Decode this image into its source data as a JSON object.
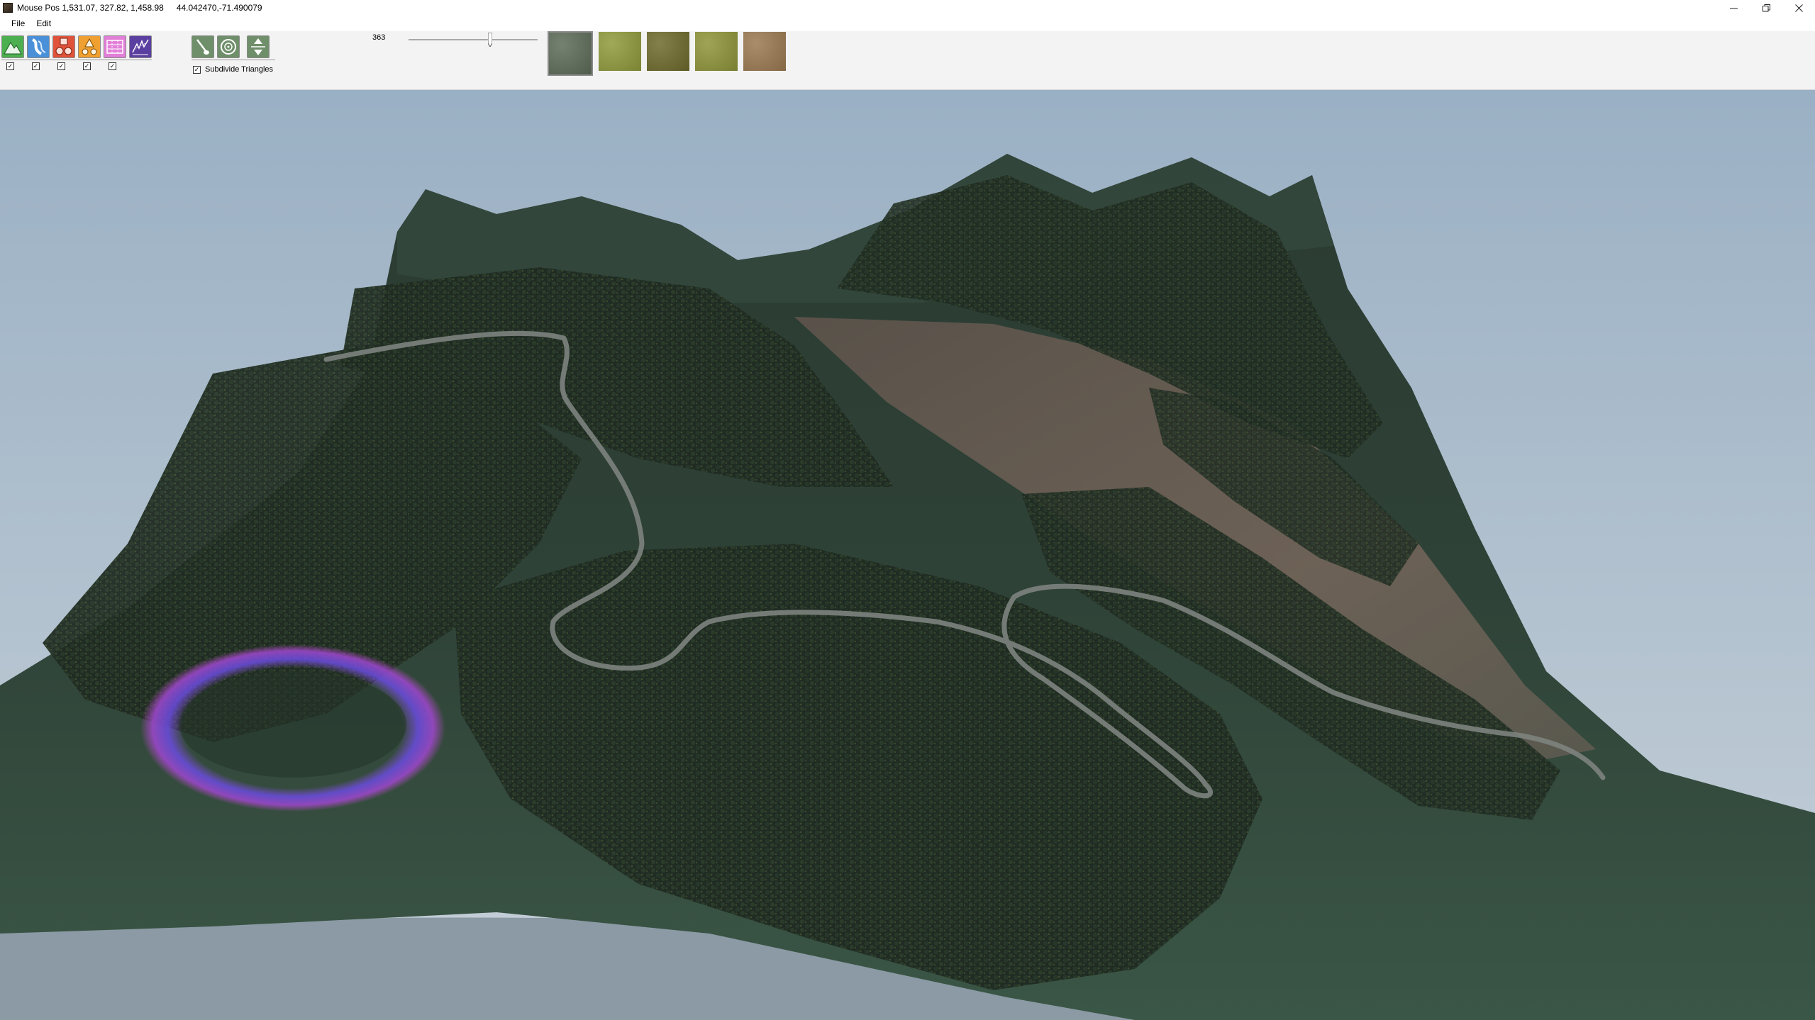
{
  "window": {
    "title": "Mouse Pos 1,531.07, 327.82, 1,458.98",
    "coords": "44.042470,-71.490079",
    "controls": {
      "minimize": "─",
      "restore": "❐",
      "close": "✕"
    }
  },
  "menu": {
    "file": "File",
    "edit": "Edit"
  },
  "toolbar": {
    "terrain_tools": [
      {
        "icon": "mountain-icon",
        "color": "#4caf50"
      },
      {
        "icon": "road-icon",
        "color": "#4a90d9"
      },
      {
        "icon": "object-shapes-icon",
        "color": "#e0533a"
      },
      {
        "icon": "tree-icon",
        "color": "#f0a030"
      },
      {
        "icon": "texture-paint-icon",
        "color": "#e27fd8"
      },
      {
        "icon": "erosion-icon",
        "color": "#5b3fa0"
      }
    ],
    "checkbox_mark": "✓",
    "brush_tools": [
      {
        "icon": "brush-icon"
      },
      {
        "icon": "circle-brush-icon"
      },
      {
        "icon": "raise-lower-icon"
      }
    ],
    "subdivide_label": "Subdivide Triangles",
    "brush_size_value": "363",
    "brush_size_fraction": 0.63,
    "textures": [
      {
        "name": "moss-texture",
        "color": "#5d6b58"
      },
      {
        "name": "grass-texture",
        "color": "#8f9a3a"
      },
      {
        "name": "dry-grass-texture",
        "color": "#6e6a2c"
      },
      {
        "name": "meadow-texture",
        "color": "#8e9438"
      },
      {
        "name": "dirt-texture",
        "color": "#9b7a52"
      }
    ]
  },
  "viewport": {
    "sky_top": "#9ab0c4",
    "sky_bottom": "#c0ccd5",
    "terrain_color": "#2f4237",
    "forest_color": "#1f2b22",
    "clearing_color": "#6b5f55",
    "road_color": "#7d837e",
    "brush_ring_color": "#8a4fd6"
  }
}
